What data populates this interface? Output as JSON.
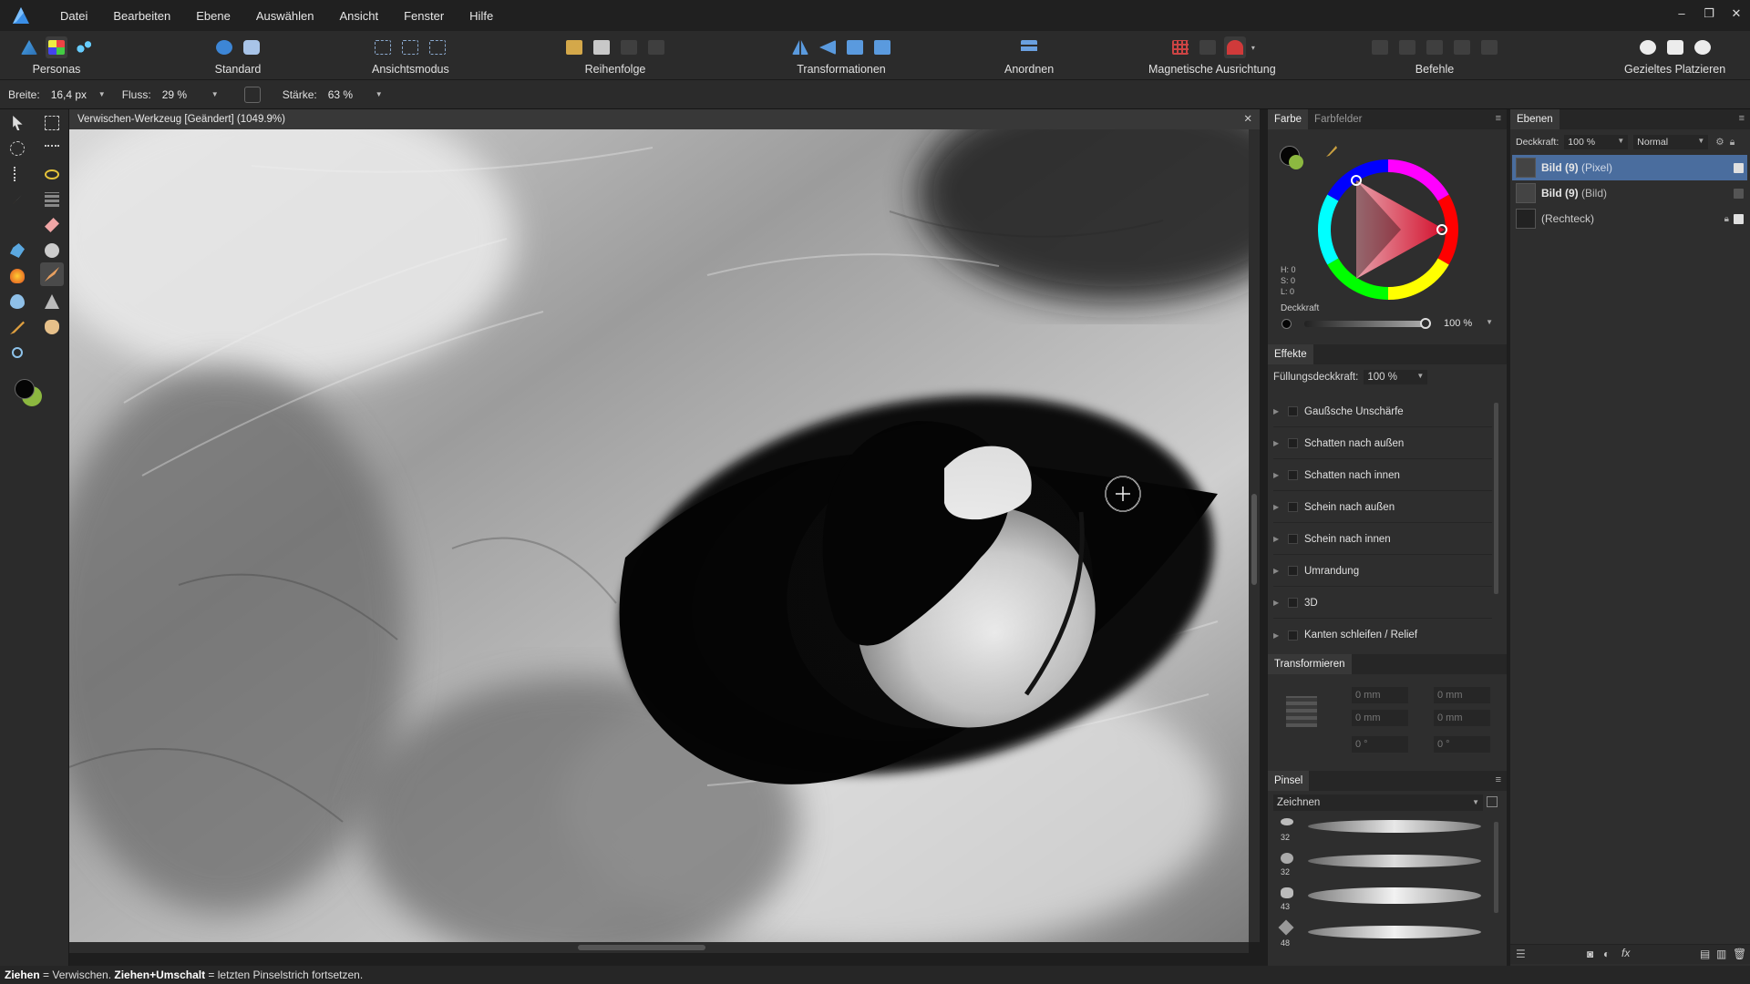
{
  "menu": {
    "items": [
      "Datei",
      "Bearbeiten",
      "Ebene",
      "Auswählen",
      "Ansicht",
      "Fenster",
      "Hilfe"
    ],
    "window_controls": [
      "–",
      "❐",
      "✕"
    ]
  },
  "toolbar": {
    "personas_label": "Personas",
    "standard_label": "Standard",
    "view_mode_label": "Ansichtsmodus",
    "order_label": "Reihenfolge",
    "transform_label": "Transformationen",
    "arrange_label": "Anordnen",
    "snapping_label": "Magnetische Ausrichtung",
    "commands_label": "Befehle",
    "placement_label": "Gezieltes Platzieren"
  },
  "context": {
    "width_label": "Breite:",
    "width_value": "16,4 px",
    "flow_label": "Fluss:",
    "flow_value": "29 %",
    "strength_label": "Stärke:",
    "strength_value": "63 %"
  },
  "document": {
    "tab_title": "Verwischen-Werkzeug [Geändert] (1049.9%)",
    "close": "✕"
  },
  "color_panel": {
    "tab_color": "Farbe",
    "tab_swatches": "Farbfelder",
    "h": "H: 0",
    "s": "S: 0",
    "l": "L: 0",
    "opacity_label": "Deckkraft",
    "opacity_value": "100 %"
  },
  "effects_panel": {
    "tab": "Effekte",
    "fill_opacity_label": "Füllungsdeckkraft:",
    "fill_opacity_value": "100 %",
    "effects": [
      "Gaußsche Unschärfe",
      "Schatten nach außen",
      "Schatten nach innen",
      "Schein nach außen",
      "Schein nach innen",
      "Umrandung",
      "3D",
      "Kanten schleifen / Relief"
    ]
  },
  "transform_panel": {
    "tab": "Transformieren",
    "fields": [
      "0 mm",
      "0 mm",
      "0 mm",
      "0 mm",
      "0 °",
      "0 °"
    ]
  },
  "brush_panel": {
    "tab": "Pinsel",
    "category": "Zeichnen",
    "brush_sizes": [
      "32",
      "32",
      "43",
      "48"
    ]
  },
  "layers_panel": {
    "tab": "Ebenen",
    "opacity_label": "Deckkraft:",
    "opacity_value": "100 %",
    "blend_mode": "Normal",
    "layers": [
      {
        "name": "Bild (9)",
        "type": "(Pixel)",
        "selected": true
      },
      {
        "name": "Bild (9)",
        "type": "(Bild)",
        "selected": false
      },
      {
        "name": "",
        "type": "(Rechteck)",
        "selected": false
      }
    ]
  },
  "status": {
    "k1": "Ziehen",
    "t1": " = Verwischen. ",
    "k2": "Ziehen+Umschalt",
    "t2": " = letzten Pinselstrich fortsetzen."
  },
  "colors": {
    "accent": "#4a6d9e",
    "ui_bg": "#2b2b2b"
  }
}
